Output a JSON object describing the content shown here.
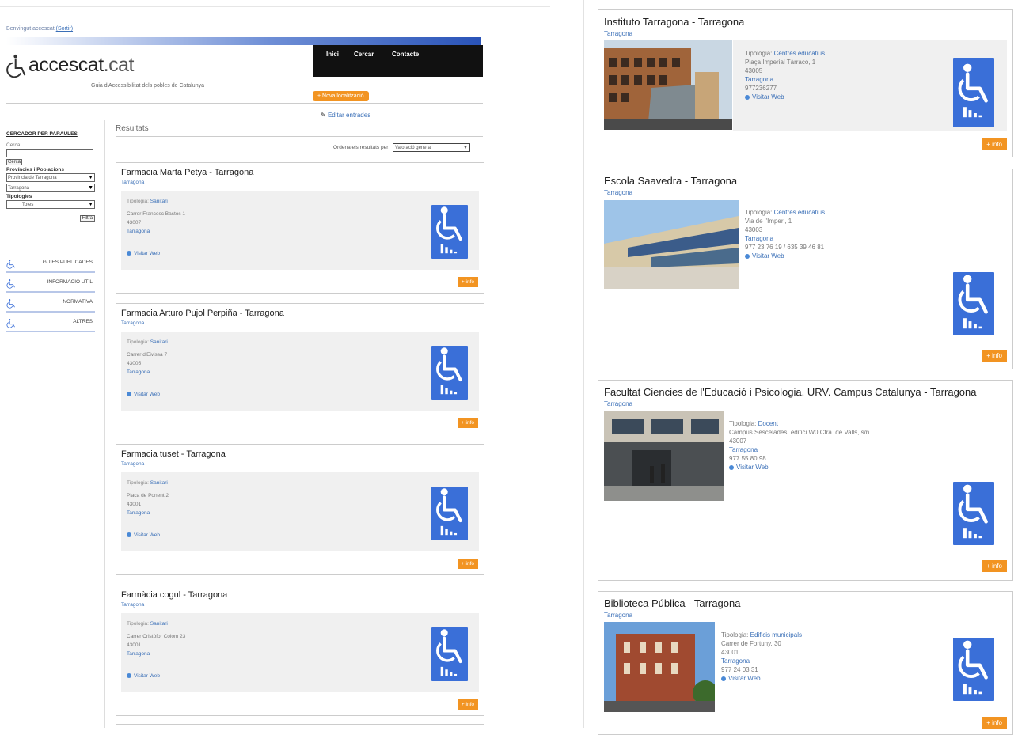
{
  "header": {
    "welcome": "Benvingut accescat",
    "logout": "(Sortir)",
    "nav": [
      "Inici",
      "Cercar",
      "Contacte"
    ],
    "logo_main": "accescat",
    "logo_suffix": ".cat",
    "logo_subtitle": "Guia d'Accessibilitat dels pobles de Catalunya",
    "new_location_button": "+ Nova localització",
    "edit_link": "Editar entrades"
  },
  "sidebar": {
    "title": "CERCADOR PER PARAULES",
    "search_label": "Cerca:",
    "search_value": "",
    "search_button": "Cerca",
    "provinces_label": "Províncies i Poblacions",
    "province_select": "Provincia de Tarragona",
    "town_select": "Tarragona",
    "types_label": "Tipologies",
    "types_select": "Totes",
    "filter_button": "Filtra",
    "menu": [
      "GUIES PUBLICADES",
      "INFORMACIO UTIL",
      "NORMATIVA",
      "ALTRES"
    ]
  },
  "results": {
    "heading": "Resultats",
    "sort_label": "Ordena els resultats per:",
    "sort_value": "Valoració general",
    "tipologia_label": "Tipologia:",
    "visit_label": "Visitar Web",
    "info_label": "+ info",
    "items": [
      {
        "title": "Farmacia Marta Petya - Tarragona",
        "city": "Tarragona",
        "type": "Sanitari",
        "address": "Carrer Francesc Bastos 1",
        "postcode": "43007",
        "town": "Tarragona"
      },
      {
        "title": "Farmacia Arturo Pujol Perpiña - Tarragona",
        "city": "Tarragona",
        "type": "Sanitari",
        "address": "Carrer d'Eivissa 7",
        "postcode": "43005",
        "town": "Tarragona"
      },
      {
        "title": "Farmacia tuset - Tarragona",
        "city": "Tarragona",
        "type": "Sanitari",
        "address": "Placa de Ponent 2",
        "postcode": "43001",
        "town": "Tarragona"
      },
      {
        "title": "Farmàcia cogul - Tarragona",
        "city": "Tarragona",
        "type": "Sanitari",
        "address": "Carrer Cristòfor Colom 23",
        "postcode": "43001",
        "town": "Tarragona"
      }
    ]
  },
  "right_results": [
    {
      "title": "Instituto Tarragona - Tarragona",
      "city": "Tarragona",
      "type": "Centres educatius",
      "address": "Plaça Imperial Tàrraco, 1",
      "postcode": "43005",
      "town": "Tarragona",
      "phone": "977236277"
    },
    {
      "title": "Escola Saavedra - Tarragona",
      "city": "Tarragona",
      "type": "Centres educatius",
      "address": "Via de l'Imperi, 1",
      "postcode": "43003",
      "town": "Tarragona",
      "phone": "977 23 76 19 / 635 39 46 81"
    },
    {
      "title": "Facultat Ciencies de l'Educació i Psicologia. URV. Campus Catalunya - Tarragona",
      "city": "Tarragona",
      "type": "Docent",
      "address": "Campus Sescelades, edifici W0 Ctra. de Valls, s/n",
      "postcode": "43007",
      "town": "Tarragona",
      "phone": "977 55 80 98"
    },
    {
      "title": "Biblioteca Pública - Tarragona",
      "city": "Tarragona",
      "type": "Edificis municipals",
      "address": "Carrer de Fortuny, 30",
      "postcode": "43001",
      "town": "Tarragona",
      "phone": "977 24 03 31"
    }
  ],
  "colors": {
    "accent": "#f29422",
    "accessibility_badge": "#3a6fd8",
    "link": "#3a6fb7"
  },
  "icons": [
    "wheelchair-icon",
    "globe-icon",
    "pencil-icon",
    "chevron-down-icon"
  ]
}
